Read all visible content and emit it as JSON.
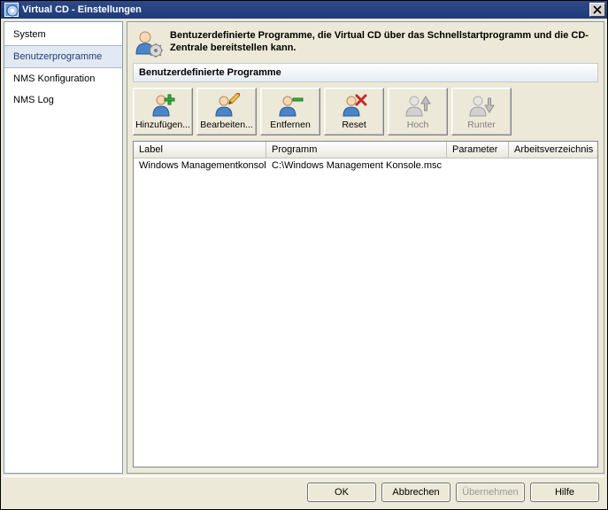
{
  "window": {
    "title": "Virtual CD - Einstellungen"
  },
  "sidebar": {
    "items": [
      {
        "label": "System",
        "selected": false
      },
      {
        "label": "Benutzerprogramme",
        "selected": true
      },
      {
        "label": "NMS Konfiguration",
        "selected": false
      },
      {
        "label": "NMS Log",
        "selected": false
      }
    ]
  },
  "info": {
    "text": "Bentuzerdefinierte Programme, die Virtual CD über das Schnellstartprogramm und die CD-Zentrale bereitstellen kann."
  },
  "section": {
    "title": "Benutzerdefinierte Programme"
  },
  "toolbar": {
    "add": {
      "label": "Hinzufügen...",
      "enabled": true
    },
    "edit": {
      "label": "Bearbeiten...",
      "enabled": true
    },
    "remove": {
      "label": "Entfernen",
      "enabled": true
    },
    "reset": {
      "label": "Reset",
      "enabled": true
    },
    "up": {
      "label": "Hoch",
      "enabled": false
    },
    "down": {
      "label": "Runter",
      "enabled": false
    }
  },
  "table": {
    "columns": {
      "label": "Label",
      "program": "Programm",
      "parameter": "Parameter",
      "workdir": "Arbeitsverzeichnis"
    },
    "rows": [
      {
        "label": "Windows Managementkonsole",
        "program": "C:\\Windows Management Konsole.msc",
        "parameter": "",
        "workdir": ""
      }
    ]
  },
  "buttons": {
    "ok": "OK",
    "cancel": "Abbrechen",
    "apply": "Übernehmen",
    "help": "Hilfe"
  }
}
